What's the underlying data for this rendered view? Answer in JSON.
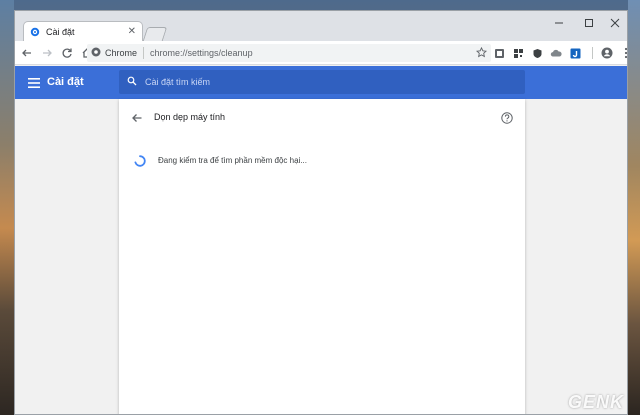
{
  "tab": {
    "title": "Cài đặt",
    "close_icon": "close-icon"
  },
  "toolbar": {
    "site_label": "Chrome",
    "url": "chrome://settings/cleanup"
  },
  "header": {
    "title": "Cài đặt",
    "search_placeholder": "Cài đặt tìm kiếm"
  },
  "page": {
    "title": "Dọn dẹp máy tính",
    "status": "Đang kiểm tra để tìm phần mềm độc hại..."
  },
  "watermark": "GENK",
  "colors": {
    "accent": "#3b6fd8",
    "search_bg": "#3060c0",
    "spinner": "#4285f4"
  }
}
